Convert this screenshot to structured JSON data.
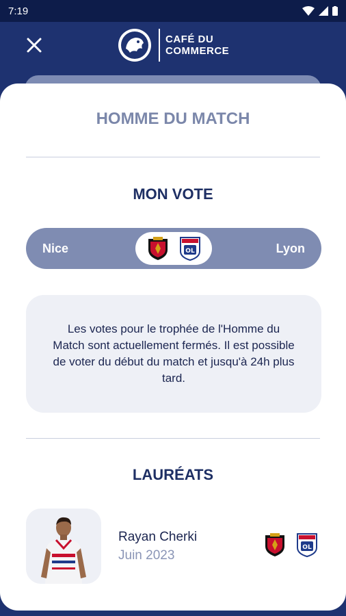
{
  "status_bar": {
    "time": "7:19"
  },
  "header": {
    "brand_line1": "CAFÉ DU",
    "brand_line2": "COMMERCE",
    "close_icon": "close-icon"
  },
  "sheet": {
    "title": "HOMME DU MATCH",
    "vote_title": "MON VOTE",
    "match": {
      "home": "Nice",
      "away": "Lyon"
    },
    "info": "Les votes pour le trophée de l'Homme du Match sont actuellement fermés. Il est possible de voter du début du match et jusqu'à 24h plus tard.",
    "laureats_title": "LAURÉATS",
    "winner": {
      "name": "Rayan Cherki",
      "date": "Juin 2023"
    }
  },
  "colors": {
    "navy": "#1e3270",
    "status_bar": "#0d1c4a",
    "pill": "#7f8cb2",
    "title_muted": "#7b87aa",
    "dark_text": "#1b2550",
    "muted_text": "#8a95b6",
    "box_bg": "#eef0f6",
    "nice_red": "#c8102e",
    "lyon_blue": "#1e3a8a"
  }
}
